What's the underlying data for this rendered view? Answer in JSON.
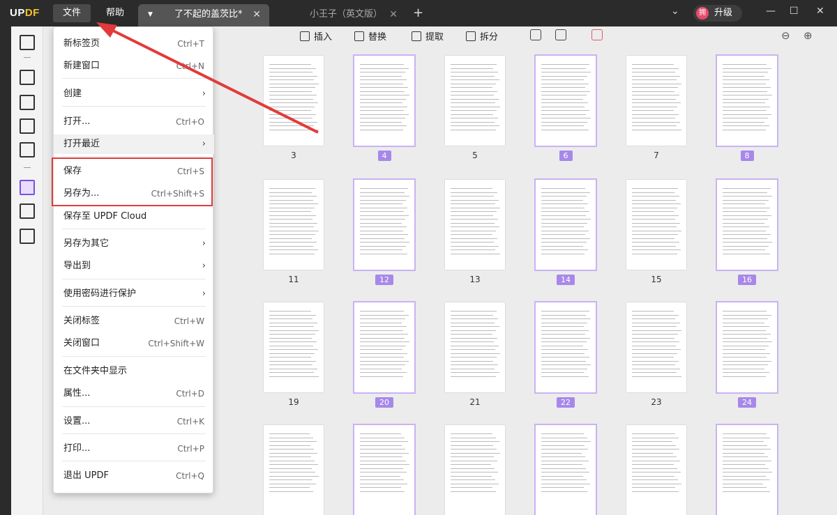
{
  "app": {
    "logo_left": "UP",
    "logo_right": "DF"
  },
  "menubar": {
    "file": "文件",
    "help": "帮助"
  },
  "tabs": [
    {
      "label": "了不起的盖茨比*",
      "active": true
    },
    {
      "label": "小王子（英文版）",
      "active": false
    }
  ],
  "titlebar": {
    "upgrade_badge": "拥",
    "upgrade_label": "升级"
  },
  "toolbar": {
    "insert": "插入",
    "replace": "替换",
    "extract": "提取",
    "split": "拆分"
  },
  "file_menu": [
    {
      "label": "新标签页",
      "shortcut": "Ctrl+T"
    },
    {
      "label": "新建窗口",
      "shortcut": "Ctrl+N"
    },
    {
      "label": "创建",
      "submenu": true
    },
    {
      "label": "打开...",
      "shortcut": "Ctrl+O"
    },
    {
      "label": "打开最近",
      "submenu": true
    },
    {
      "label": "保存",
      "shortcut": "Ctrl+S"
    },
    {
      "label": "另存为...",
      "shortcut": "Ctrl+Shift+S"
    },
    {
      "label": "保存至 UPDF Cloud"
    },
    {
      "label": "另存为其它",
      "submenu": true
    },
    {
      "label": "导出到",
      "submenu": true
    },
    {
      "label": "使用密码进行保护",
      "submenu": true
    },
    {
      "label": "关闭标签",
      "shortcut": "Ctrl+W"
    },
    {
      "label": "关闭窗口",
      "shortcut": "Ctrl+Shift+W"
    },
    {
      "label": "在文件夹中显示"
    },
    {
      "label": "属性...",
      "shortcut": "Ctrl+D"
    },
    {
      "label": "设置...",
      "shortcut": "Ctrl+K"
    },
    {
      "label": "打印...",
      "shortcut": "Ctrl+P"
    },
    {
      "label": "退出 UPDF",
      "shortcut": "Ctrl+Q"
    }
  ],
  "pages": [
    {
      "num": "3",
      "selected": false
    },
    {
      "num": "4",
      "selected": true
    },
    {
      "num": "5",
      "selected": false
    },
    {
      "num": "6",
      "selected": true
    },
    {
      "num": "7",
      "selected": false
    },
    {
      "num": "8",
      "selected": true
    },
    {
      "num": "11",
      "selected": false
    },
    {
      "num": "12",
      "selected": true
    },
    {
      "num": "13",
      "selected": false
    },
    {
      "num": "14",
      "selected": true
    },
    {
      "num": "15",
      "selected": false
    },
    {
      "num": "16",
      "selected": true
    },
    {
      "num": "19",
      "selected": false
    },
    {
      "num": "20",
      "selected": true
    },
    {
      "num": "21",
      "selected": false
    },
    {
      "num": "22",
      "selected": true
    },
    {
      "num": "23",
      "selected": false
    },
    {
      "num": "24",
      "selected": true
    }
  ],
  "colors": {
    "accent": "#a788ea",
    "highlight_box": "#e23a3a",
    "arrow": "#e23a3a"
  }
}
